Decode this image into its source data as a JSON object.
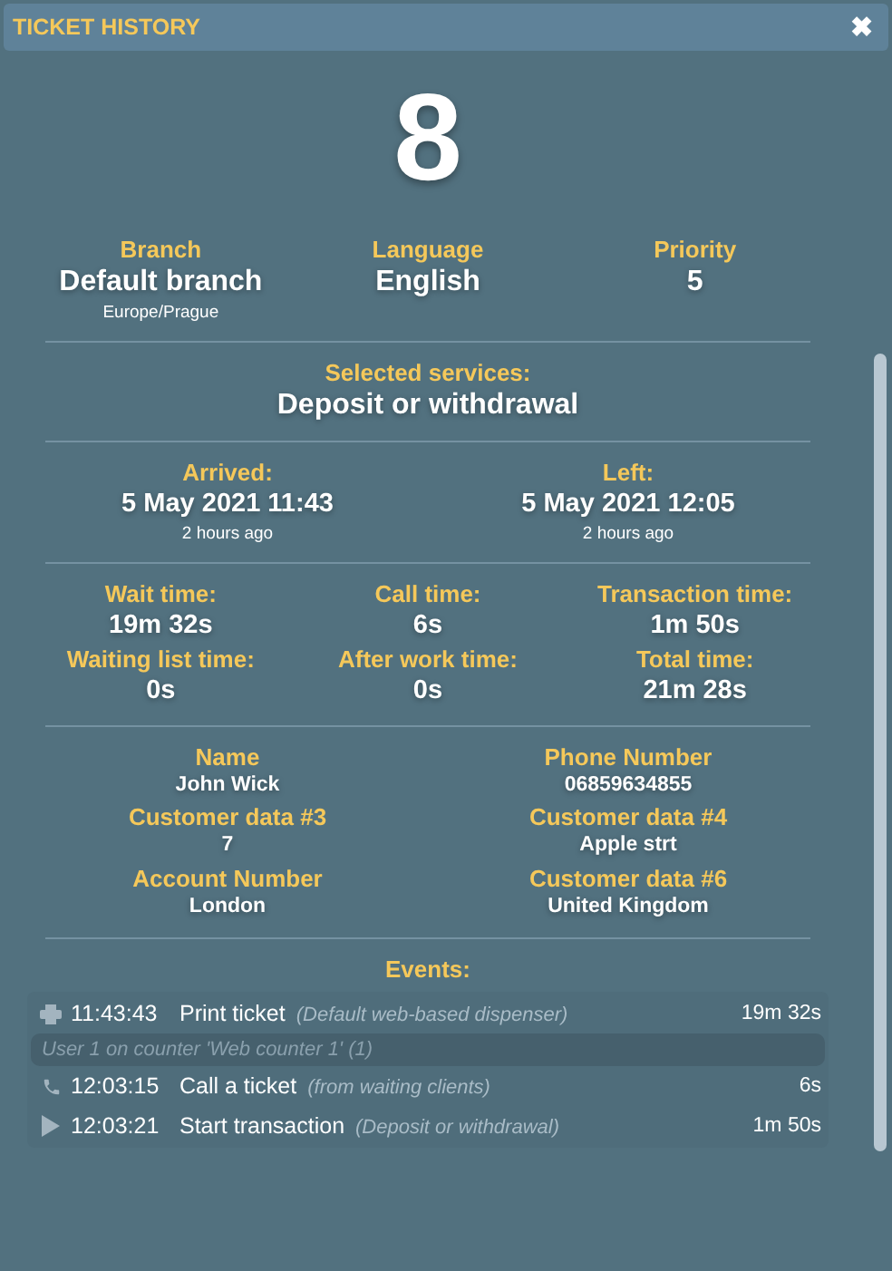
{
  "window": {
    "title": "TICKET HISTORY",
    "close": "✖"
  },
  "ticket_number": "8",
  "summary": [
    {
      "label": "Branch",
      "value": "Default branch",
      "note": "Europe/Prague"
    },
    {
      "label": "Language",
      "value": "English"
    },
    {
      "label": "Priority",
      "value": "5"
    }
  ],
  "services": {
    "label": "Selected services:",
    "value": "Deposit or withdrawal"
  },
  "timestamps": [
    {
      "label": "Arrived:",
      "value": "5 May 2021 11:43",
      "note": "2 hours ago"
    },
    {
      "label": "Left:",
      "value": "5 May 2021 12:05",
      "note": "2 hours ago"
    }
  ],
  "times": [
    {
      "label": "Wait time:",
      "value": "19m 32s"
    },
    {
      "label": "Call time:",
      "value": "6s"
    },
    {
      "label": "Transaction time:",
      "value": "1m 50s"
    },
    {
      "label": "Waiting list time:",
      "value": "0s"
    },
    {
      "label": "After work time:",
      "value": "0s"
    },
    {
      "label": "Total time:",
      "value": "21m 28s"
    }
  ],
  "customer": [
    {
      "label": "Name",
      "value": "John Wick"
    },
    {
      "label": "Phone Number",
      "value": "06859634855"
    },
    {
      "label": "Customer data #3",
      "value": "7"
    },
    {
      "label": "Customer data #4",
      "value": "Apple strt"
    },
    {
      "label": "Account Number",
      "value": "London"
    },
    {
      "label": "Customer data #6",
      "value": "United Kingdom"
    }
  ],
  "events": {
    "label": "Events:",
    "items": [
      {
        "kind": "print",
        "time": "11:43:43",
        "action": "Print ticket",
        "detail": "(Default web-based dispenser)",
        "duration": "19m 32s"
      },
      {
        "kind": "note",
        "text": "User 1 on counter 'Web counter 1' (1)"
      },
      {
        "kind": "call",
        "time": "12:03:15",
        "action": "Call a ticket",
        "detail": "(from waiting clients)",
        "duration": "6s"
      },
      {
        "kind": "transaction",
        "time": "12:03:21",
        "action": "Start transaction",
        "detail": "(Deposit or withdrawal)",
        "duration": "1m 50s"
      }
    ]
  }
}
